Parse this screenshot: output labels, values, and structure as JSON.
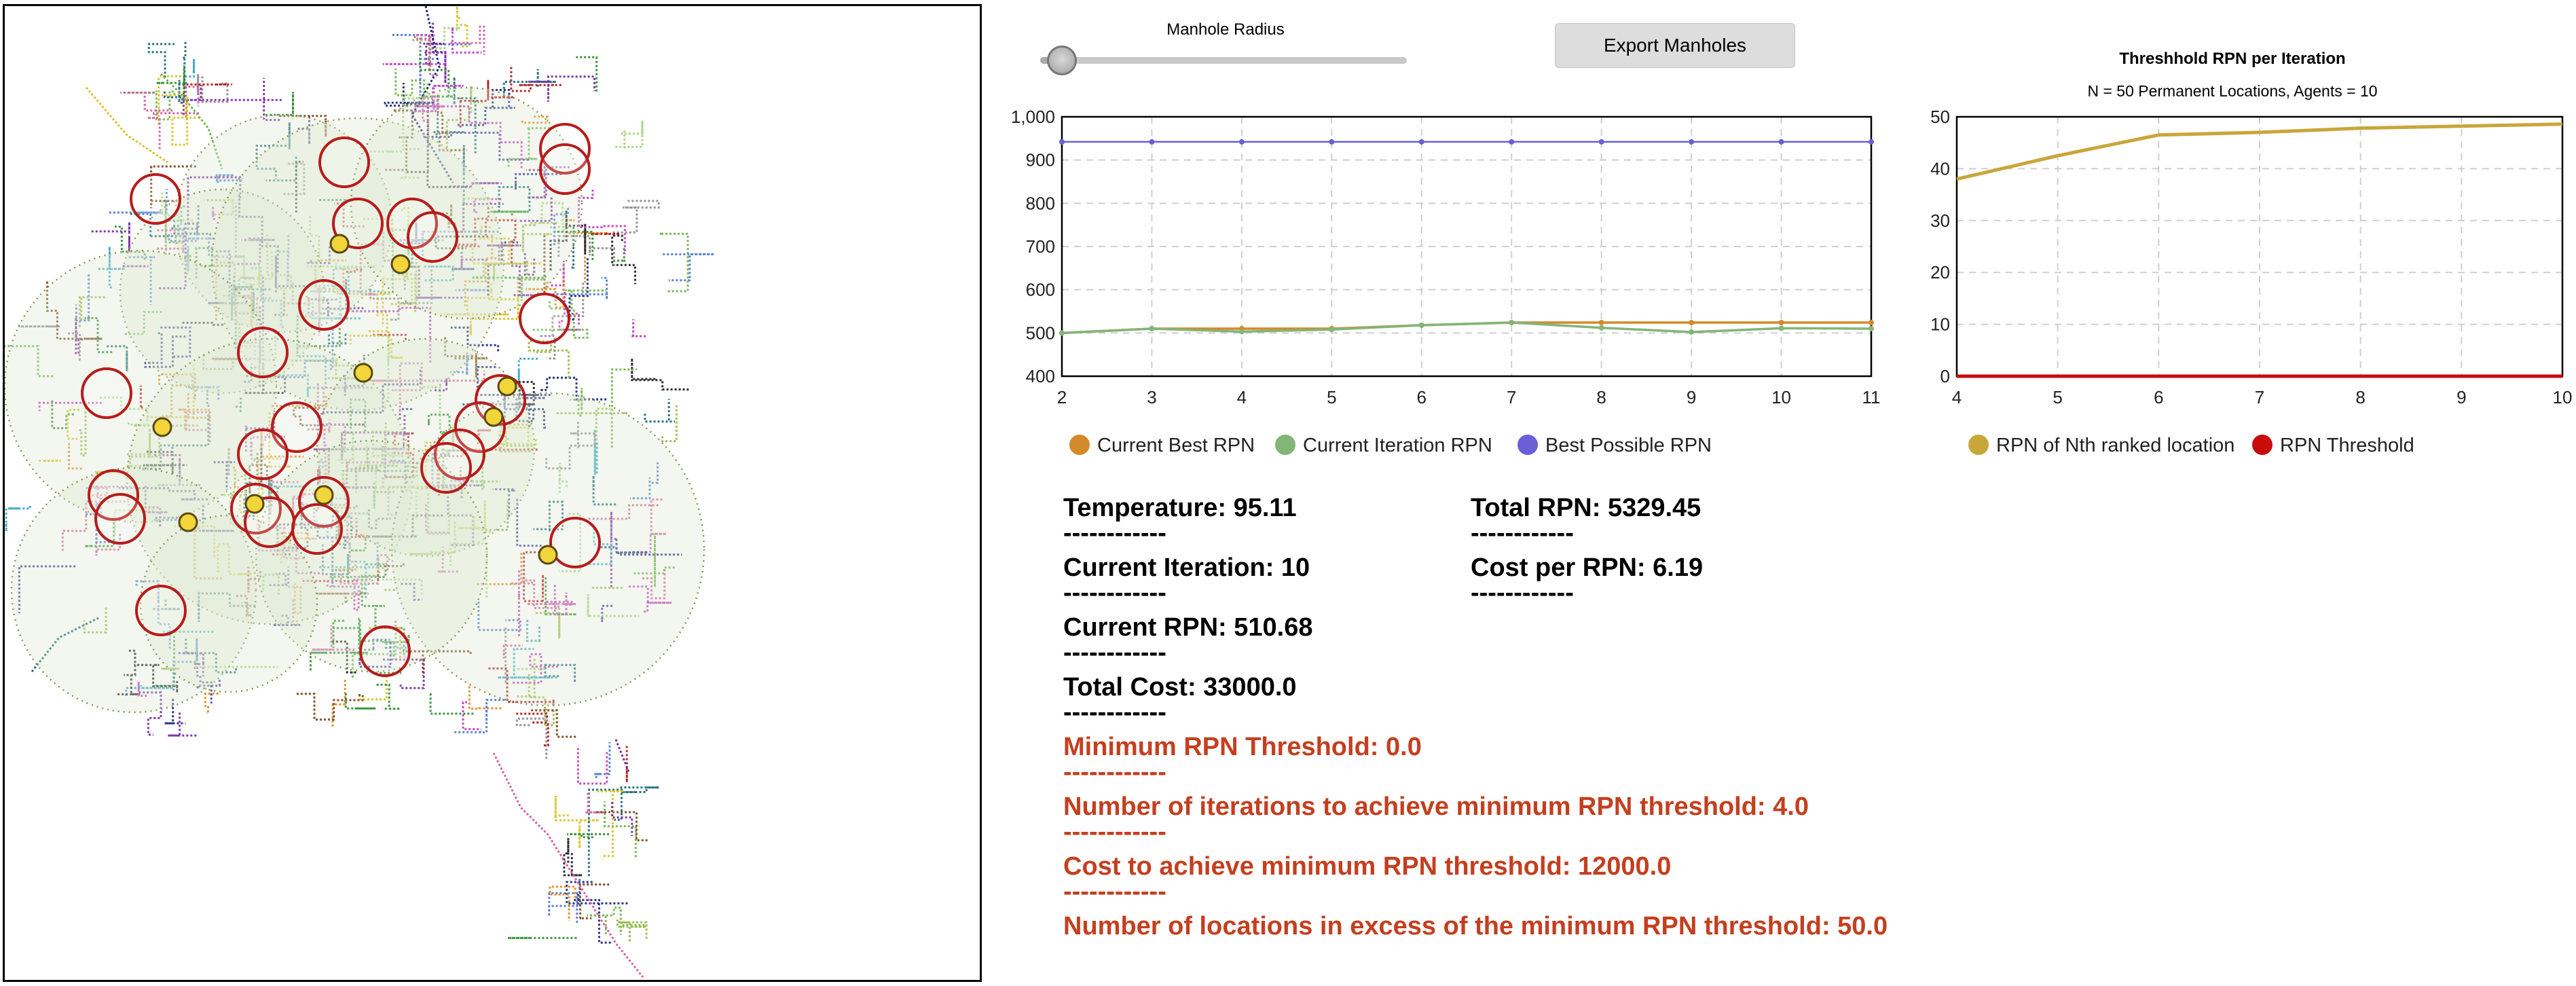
{
  "controls": {
    "slider_label": "Manhole Radius",
    "slider_value_fraction": 0.06,
    "export_button": "Export Manholes"
  },
  "map": {
    "accent_colors": {
      "coverage_fill": "#dce8d2",
      "coverage_stroke": "#8a9a55",
      "manhole_stroke": "#b71c1c",
      "agent_fill": "#f2d43b"
    }
  },
  "rpn_chart": {
    "legend": {
      "current_best": "Current Best RPN",
      "current_iteration": "Current Iteration RPN",
      "best_possible": "Best Possible RPN"
    }
  },
  "threshold_chart": {
    "title": "Threshhold RPN per Iteration",
    "subtitle": "N = 50 Permanent Locations, Agents = 10",
    "legend": {
      "nth_ranked": "RPN of Nth ranked location",
      "threshold": "RPN Threshold"
    }
  },
  "chart_data": [
    {
      "type": "line",
      "x": [
        2,
        3,
        4,
        5,
        6,
        7,
        8,
        9,
        10,
        11
      ],
      "xlim": [
        2,
        11
      ],
      "ylim": [
        400,
        1000
      ],
      "yticks": [
        400,
        500,
        600,
        700,
        800,
        900,
        1000
      ],
      "ytick_labels": [
        "400",
        "500",
        "600",
        "700",
        "800",
        "900",
        "1,000"
      ],
      "xticks": [
        2,
        3,
        4,
        5,
        6,
        7,
        8,
        9,
        10,
        11
      ],
      "grid": true,
      "legend_position": "bottom",
      "series": [
        {
          "name": "Current Best RPN",
          "color": "#d4892b",
          "values": [
            500,
            510,
            510,
            510,
            518,
            524,
            524,
            524,
            524,
            524
          ]
        },
        {
          "name": "Current Iteration RPN",
          "color": "#82b578",
          "values": [
            500,
            510,
            503,
            508,
            518,
            524,
            512,
            502,
            511,
            510
          ]
        },
        {
          "name": "Best Possible RPN",
          "color": "#6a5fd6",
          "values": [
            942,
            942,
            942,
            942,
            942,
            942,
            942,
            942,
            942,
            942
          ]
        }
      ]
    },
    {
      "type": "line",
      "title": "Threshhold RPN per Iteration",
      "subtitle": "N = 50 Permanent Locations, Agents = 10",
      "x": [
        4,
        5,
        6,
        7,
        8,
        9,
        10
      ],
      "xlim": [
        4,
        10
      ],
      "ylim": [
        0,
        50
      ],
      "yticks": [
        0,
        10,
        20,
        30,
        40,
        50
      ],
      "xticks": [
        4,
        5,
        6,
        7,
        8,
        9,
        10
      ],
      "grid": true,
      "legend_position": "bottom",
      "series": [
        {
          "name": "RPN of Nth ranked location",
          "color": "#c9a63a",
          "values": [
            38,
            42.5,
            46.5,
            47,
            47.8,
            48.2,
            48.6
          ]
        },
        {
          "name": "RPN Threshold",
          "color": "#c90b0b",
          "values": [
            0,
            0,
            0,
            0,
            0,
            0,
            0
          ]
        }
      ]
    }
  ],
  "stats": {
    "separator": "------------",
    "temperature": "Temperature: 95.11",
    "current_iteration": "Current Iteration: 10",
    "current_rpn": "Current RPN: 510.68",
    "total_cost": "Total Cost: 33000.0",
    "total_rpn": "Total RPN: 5329.45",
    "cost_per_rpn": "Cost per RPN: 6.19",
    "min_threshold": "Minimum RPN Threshold: 0.0",
    "iterations_to_threshold": "Number of iterations to achieve minimum RPN threshold: 4.0",
    "cost_to_threshold": "Cost to achieve minimum RPN threshold: 12000.0",
    "locations_in_excess": "Number of locations in excess of the minimum RPN threshold: 50.0",
    "highlight_color": "#c43f1f"
  }
}
